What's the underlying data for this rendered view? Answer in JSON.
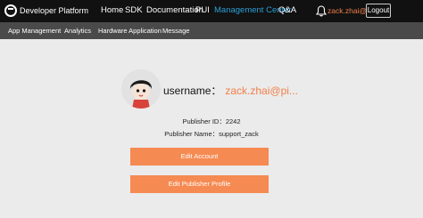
{
  "header": {
    "brand": "Developer Platform",
    "nav": [
      "Home",
      "SDK",
      "Documentation",
      "PUI",
      "Management Center",
      "Q&A"
    ],
    "active": "Management Center",
    "user_display": "zack.zhai@pi...",
    "logout_label": "Logout",
    "accent_color": "#2a9fd6"
  },
  "subnav": [
    "App Management",
    "Analytics",
    "Hardware Application",
    "Message"
  ],
  "profile": {
    "username_label": "username：",
    "username_value": "zack.zhai@pi...",
    "publisher_id": "Publisher ID：2242",
    "publisher_name": "Publisher Name：support_zack"
  },
  "actions": {
    "edit_account": "Edit Account",
    "edit_profile": "Edit Publisher Profile",
    "button_color": "#f58a52"
  },
  "icons": [
    "logo-icon",
    "bell-icon",
    "avatar"
  ]
}
